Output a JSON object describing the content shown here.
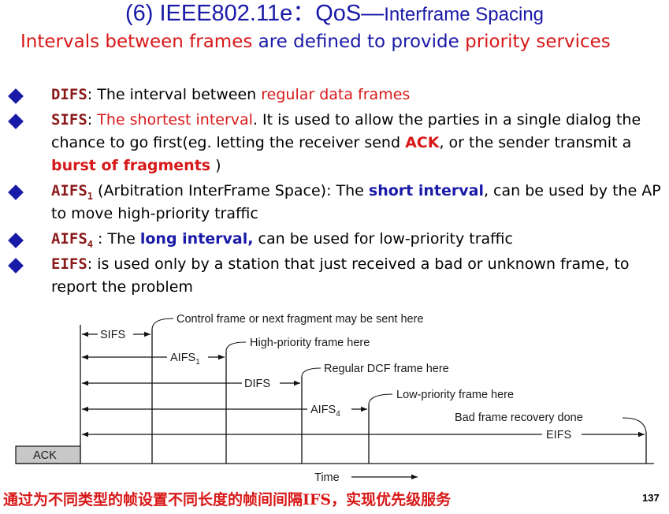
{
  "title": {
    "main": "(6) IEEE802.11e：QoS—",
    "rest": "Interframe Spacing"
  },
  "subtitle": {
    "part1": "Intervals between frames",
    "part2": " are defined to provide ",
    "part3": "priority services"
  },
  "bullets": [
    {
      "term": "DIFS",
      "t1": ": The interval between ",
      "t2": "regular data frames"
    },
    {
      "term": "SIFS",
      "t1": ": ",
      "t2": "The shortest interval",
      "t3": ". It is used to allow the parties in a single dialog the chance to go first(eg. letting the receiver send ",
      "t4": "ACK",
      "t5": ", or the sender transmit a ",
      "t6": "burst of fragments",
      "t7": " )"
    },
    {
      "term": "AIFS",
      "sub": "1",
      "t1": " (Arbitration InterFrame Space): The ",
      "t2": "short interval",
      "t3": ", can be used by the AP to move high-priority traffic"
    },
    {
      "term": "AIFS",
      "sub": "4",
      "t1": " : The ",
      "t2": "long interval,",
      "t3": " can be used for low-priority traffic"
    },
    {
      "term": "EIFS",
      "t1": ": is used only by a station that just received a bad or unknown frame, to report the problem"
    }
  ],
  "diagram": {
    "ack": "ACK",
    "sifs": "SIFS",
    "aifs1_main": "AIFS",
    "aifs1_sub": "1",
    "difs": "DIFS",
    "aifs4_main": "AIFS",
    "aifs4_sub": "4",
    "eifs": "EIFS",
    "time": "Time",
    "notes": {
      "control": "Control frame or next fragment may be sent here",
      "high": "High-priority frame here",
      "regular": "Regular DCF frame here",
      "low": "Low-priority frame here",
      "bad": "Bad frame recovery done"
    }
  },
  "footer": "通过为不同类型的帧设置不同长度的帧间间隔IFS，实现优先级服务",
  "page_number": "137",
  "colors": {
    "title_blue": "#1a1aa8",
    "highlight_red": "#d81818",
    "term_maroon": "#8a1a1a",
    "ack_box": "#c8c8c8"
  },
  "icons": {
    "bullet": "blue-diamond-icon"
  }
}
